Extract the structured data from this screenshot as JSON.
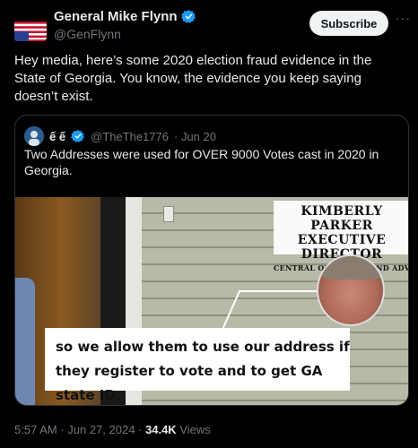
{
  "author": {
    "display_name": "General Mike Flynn",
    "handle": "@GenFlynn",
    "avatar_icon": "upside-down-us-flag-icon",
    "verified_icon": "verified-badge-icon"
  },
  "subscribe_label": "Subscribe",
  "more_icon": "more-icon",
  "more_label": "···",
  "tweet_text": "Hey media, here’s some 2020 election fraud evidence in the State of Georgia. You know, the evidence you keep saying doesn’t exist.",
  "quoted": {
    "name": "ế ế",
    "handle": "@TheThe1776",
    "date": "· Jun 20",
    "text": "Two Addresses were used for OVER 9000 Votes cast in 2020 in Georgia.",
    "avatar_icon": "avatar-icon",
    "verified_icon": "verified-badge-icon",
    "video": {
      "lower_third_name": "Kimberly Parker",
      "lower_third_title": "Executive Director",
      "lower_third_org": "Central Outreach and Advocacy Cent",
      "caption": "so we allow them to use our address if they register to vote and to get GA state ID."
    }
  },
  "meta": {
    "time": "5:57 AM · Jun 27, 2024 ·",
    "views_count": "34.4K",
    "views_label": "Views"
  },
  "colors": {
    "background": "#000000",
    "text": "#e7e9ea",
    "secondary": "#71767b",
    "verified": "#1d9bf0",
    "border": "#2f3336"
  }
}
